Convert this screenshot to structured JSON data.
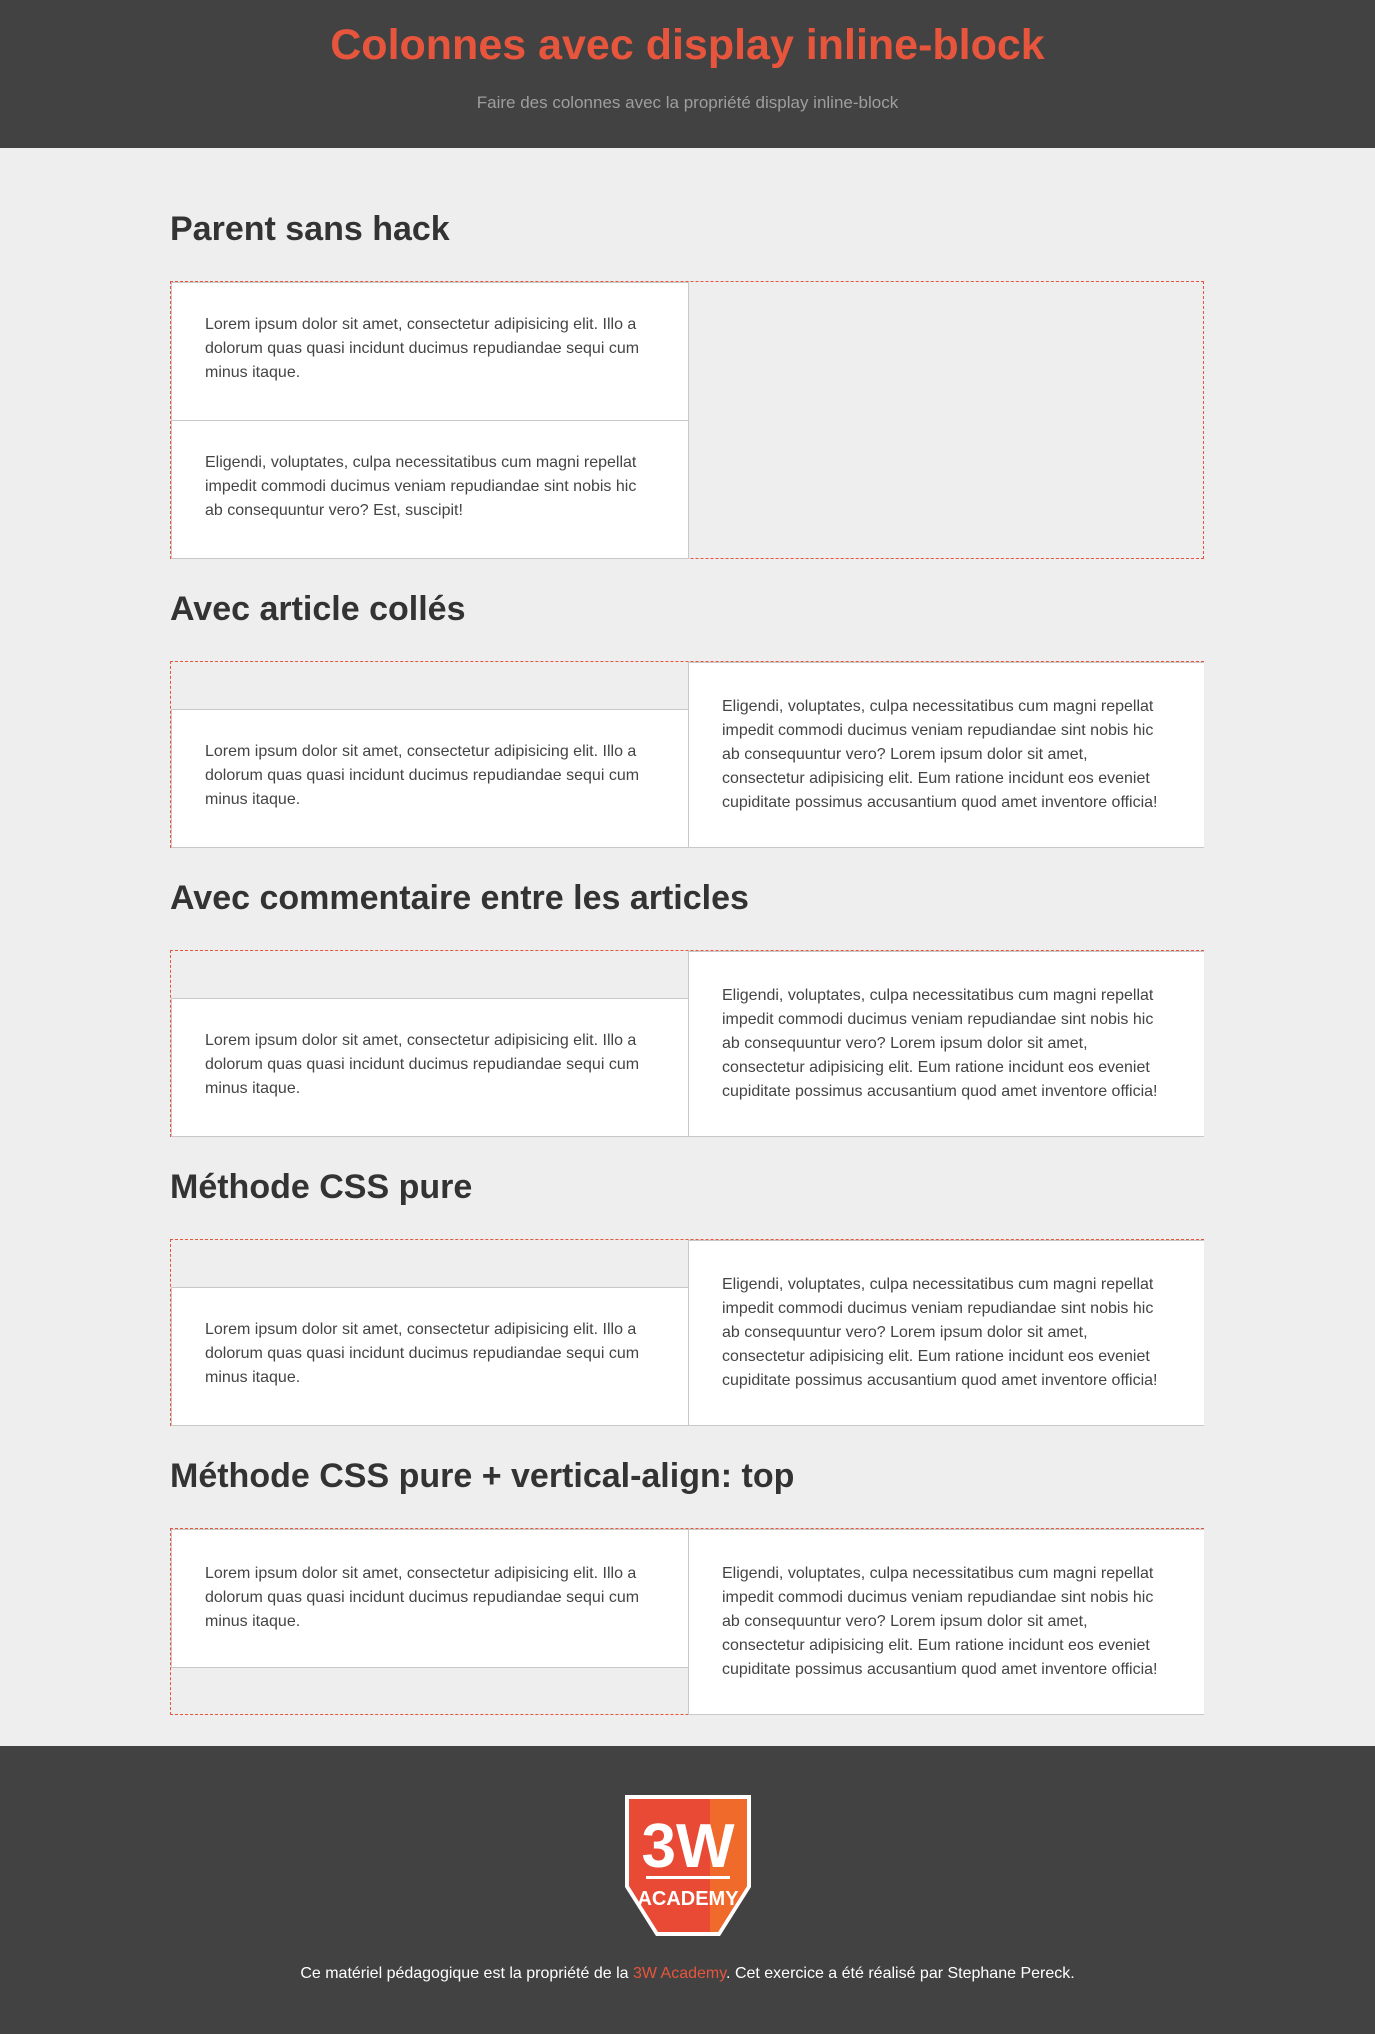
{
  "header": {
    "title": "Colonnes avec display inline-block",
    "subtitle": "Faire des colonnes avec la propriété display inline-block"
  },
  "sections": [
    {
      "title": "Parent sans hack",
      "articles": [
        "Lorem ipsum dolor sit amet, consectetur adipisicing elit. Illo a dolorum quas quasi incidunt ducimus repudiandae sequi cum minus itaque.",
        "Eligendi, voluptates, culpa necessitatibus cum magni repellat impedit commodi ducimus veniam repudiandae sint nobis hic ab consequuntur vero? Est, suscipit!"
      ]
    },
    {
      "title": "Avec article collés",
      "articles": [
        "Lorem ipsum dolor sit amet, consectetur adipisicing elit. Illo a dolorum quas quasi incidunt ducimus repudiandae sequi cum minus itaque.",
        "Eligendi, voluptates, culpa necessitatibus cum magni repellat impedit commodi ducimus veniam repudiandae sint nobis hic ab consequuntur vero? Lorem ipsum dolor sit amet, consectetur adipisicing elit. Eum ratione incidunt eos eveniet cupiditate possimus accusantium quod amet inventore officia!"
      ]
    },
    {
      "title": "Avec commentaire entre les articles",
      "articles": [
        "Lorem ipsum dolor sit amet, consectetur adipisicing elit. Illo a dolorum quas quasi incidunt ducimus repudiandae sequi cum minus itaque.",
        "Eligendi, voluptates, culpa necessitatibus cum magni repellat impedit commodi ducimus veniam repudiandae sint nobis hic ab consequuntur vero? Lorem ipsum dolor sit amet, consectetur adipisicing elit. Eum ratione incidunt eos eveniet cupiditate possimus accusantium quod amet inventore officia!"
      ]
    },
    {
      "title": "Méthode CSS pure",
      "articles": [
        "Lorem ipsum dolor sit amet, consectetur adipisicing elit. Illo a dolorum quas quasi incidunt ducimus repudiandae sequi cum minus itaque.",
        "Eligendi, voluptates, culpa necessitatibus cum magni repellat impedit commodi ducimus veniam repudiandae sint nobis hic ab consequuntur vero? Lorem ipsum dolor sit amet, consectetur adipisicing elit. Eum ratione incidunt eos eveniet cupiditate possimus accusantium quod amet inventore officia!"
      ]
    },
    {
      "title": "Méthode CSS pure + vertical-align: top",
      "articles": [
        "Lorem ipsum dolor sit amet, consectetur adipisicing elit. Illo a dolorum quas quasi incidunt ducimus repudiandae sequi cum minus itaque.",
        "Eligendi, voluptates, culpa necessitatibus cum magni repellat impedit commodi ducimus veniam repudiandae sint nobis hic ab consequuntur vero? Lorem ipsum dolor sit amet, consectetur adipisicing elit. Eum ratione incidunt eos eveniet cupiditate possimus accusantium quod amet inventore officia!"
      ]
    }
  ],
  "footer": {
    "logo": {
      "top": "3W",
      "bottom": "ACADEMY"
    },
    "text_before": "Ce matériel pédagogique est la propriété de la ",
    "brand": "3W Academy",
    "text_after": ". Cet exercice a été réalisé par Stephane Pereck."
  },
  "colors": {
    "accent": "#e8553d",
    "header_bg": "#424242",
    "page_bg": "#eeeeee"
  }
}
